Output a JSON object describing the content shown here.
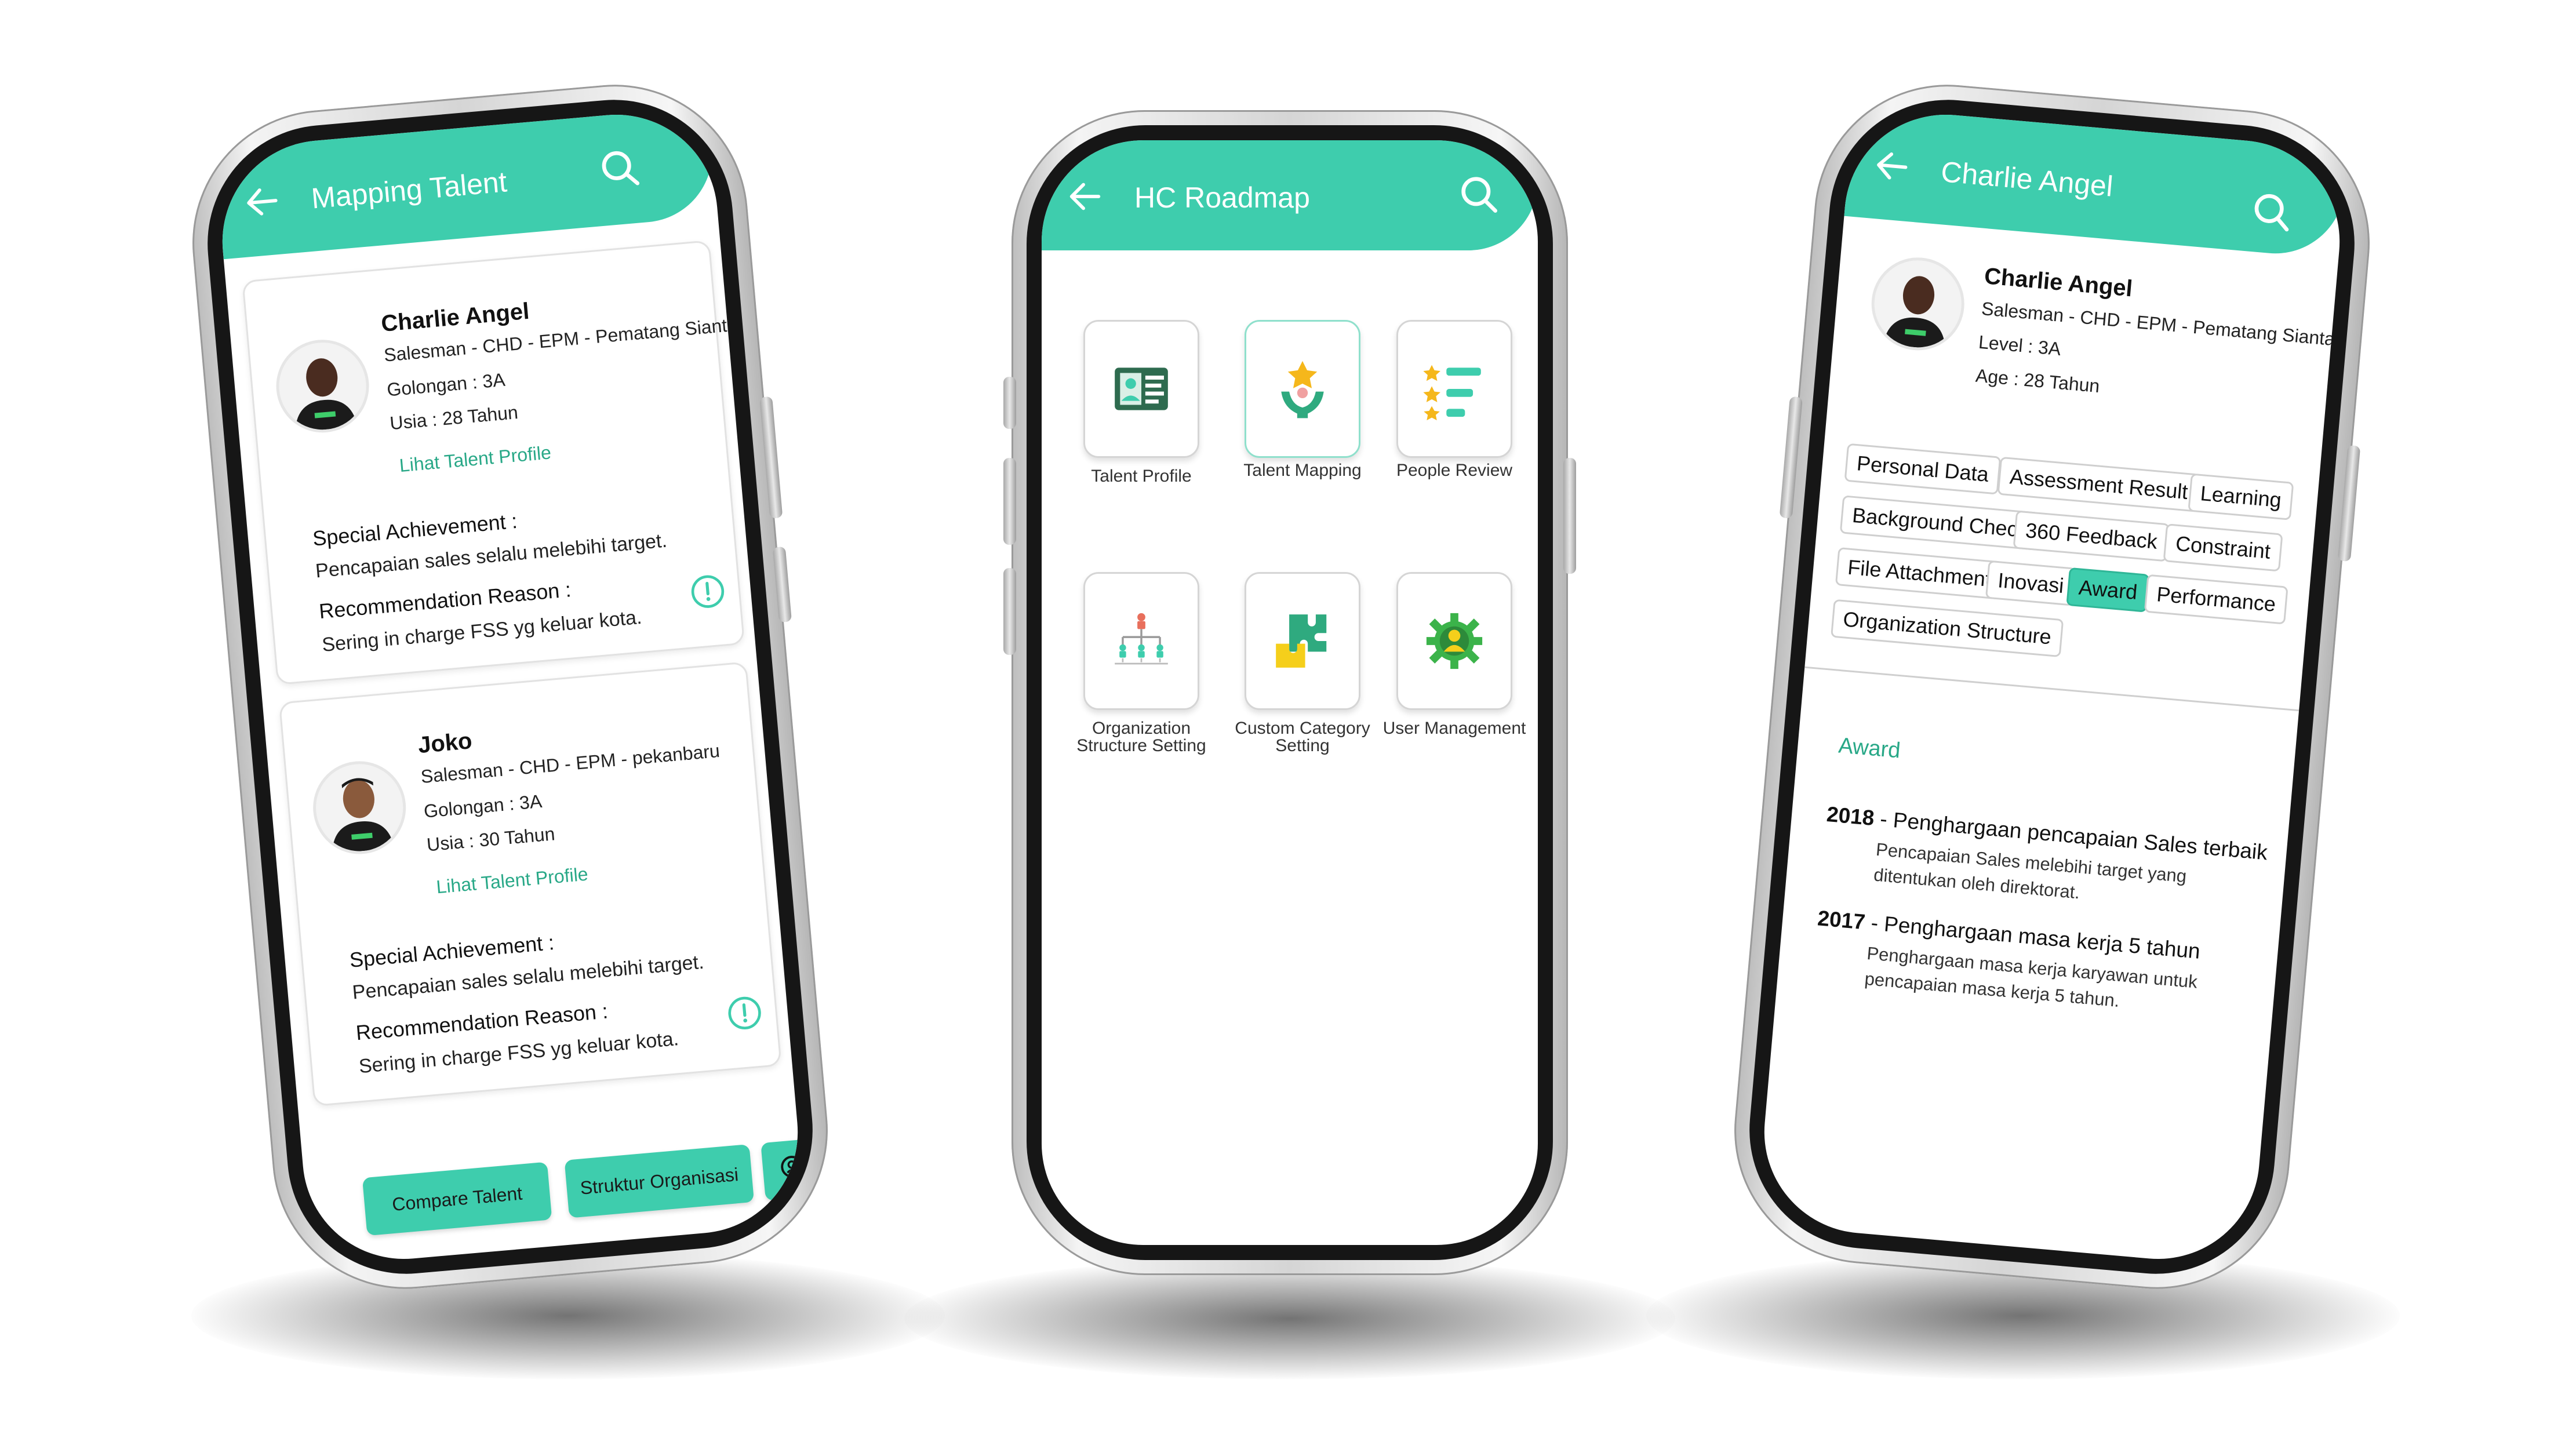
{
  "mapping_screen": {
    "title": "Mapping Talent",
    "cards": [
      {
        "name": "Charlie Angel",
        "position": "Salesman - CHD - EPM - Pematang Siantar",
        "grade": "Golongan : 3A",
        "age": "Usia : 28 Tahun",
        "link": "Lihat Talent Profile",
        "achievement_label": "Special Achievement :",
        "achievement": "Pencapaian sales selalu melebihi target.",
        "reason_label": "Recommendation Reason :",
        "reason": "Sering in charge FSS yg keluar kota."
      },
      {
        "name": "Joko",
        "position": "Salesman - CHD - EPM - pekanbaru",
        "grade": "Golongan : 3A",
        "age": "Usia : 30 Tahun",
        "link": "Lihat Talent Profile",
        "achievement_label": "Special Achievement :",
        "achievement": "Pencapaian sales selalu melebihi target.",
        "reason_label": "Recommendation Reason :",
        "reason": "Sering in charge FSS yg keluar kota."
      }
    ],
    "buttons": {
      "compare": "Compare Talent",
      "structure": "Struktur Organisasi"
    }
  },
  "roadmap_screen": {
    "title": "HC Roadmap",
    "menu": [
      {
        "label": "Talent Profile",
        "icon": "id-card-icon"
      },
      {
        "label": "Talent Mapping",
        "icon": "star-hands-icon"
      },
      {
        "label": "People Review",
        "icon": "star-list-icon"
      },
      {
        "label": "Organization Structure Setting",
        "icon": "org-chart-icon"
      },
      {
        "label": "Custom Category Setting",
        "icon": "puzzle-icon"
      },
      {
        "label": "User Management",
        "icon": "user-gear-icon"
      }
    ]
  },
  "profile_screen": {
    "title": "Charlie Angel",
    "name": "Charlie Angel",
    "position": "Salesman - CHD - EPM - Pematang Siantar",
    "level": "Level : 3A",
    "age": "Age : 28 Tahun",
    "tabs": [
      "Personal Data",
      "Assessment Result",
      "Learning",
      "Background Check",
      "360 Feedback",
      "Constraint",
      "File Attachment",
      "Inovasi",
      "Award",
      "Performance",
      "Organization Structure"
    ],
    "active_tab": "Award",
    "section_title": "Award",
    "awards": [
      {
        "year": "2018",
        "title": " - Penghargaan pencapaian Sales terbaik",
        "desc_line1": "Pencapaian Sales melebihi target yang",
        "desc_line2": "ditentukan oleh direktorat."
      },
      {
        "year": "2017",
        "title": " - Penghargaan masa kerja 5 tahun",
        "desc_line1": "Penghargaan masa kerja karyawan untuk",
        "desc_line2": "pencapaian masa kerja 5 tahun."
      }
    ]
  },
  "colors": {
    "accent": "#3ecdad",
    "link": "#28a887",
    "frame": "#161616"
  }
}
